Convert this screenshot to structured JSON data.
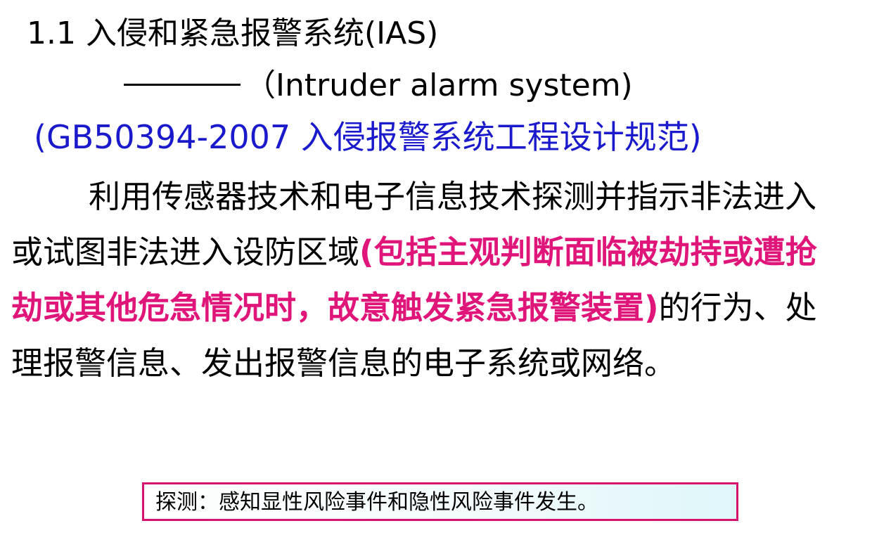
{
  "title": "1.1 入侵和紧急报警系统(IAS)",
  "subtitle": "（Intruder alarm system)",
  "standard": "(GB50394-2007 入侵报警系统工程设计规范)",
  "definition": {
    "line1": "利用传感器技术和电子信息技术探测并指示非法进入",
    "line2_plain": "或试图非法进入设防区域",
    "line2_highlight": "(包括主观判断面临被劫持或遭抢",
    "line3_highlight": "劫或其他危急情况时，故意触发紧急报警装置)",
    "line3_plain": "的行为、处",
    "line4": "理报警信息、发出报警信息的电子系统或网络。"
  },
  "note": "探测：感知显性风险事件和隐性风险事件发生。",
  "colors": {
    "standard_text": "#1a1acc",
    "highlight_text": "#e0157a",
    "note_border": "#d6126f"
  }
}
